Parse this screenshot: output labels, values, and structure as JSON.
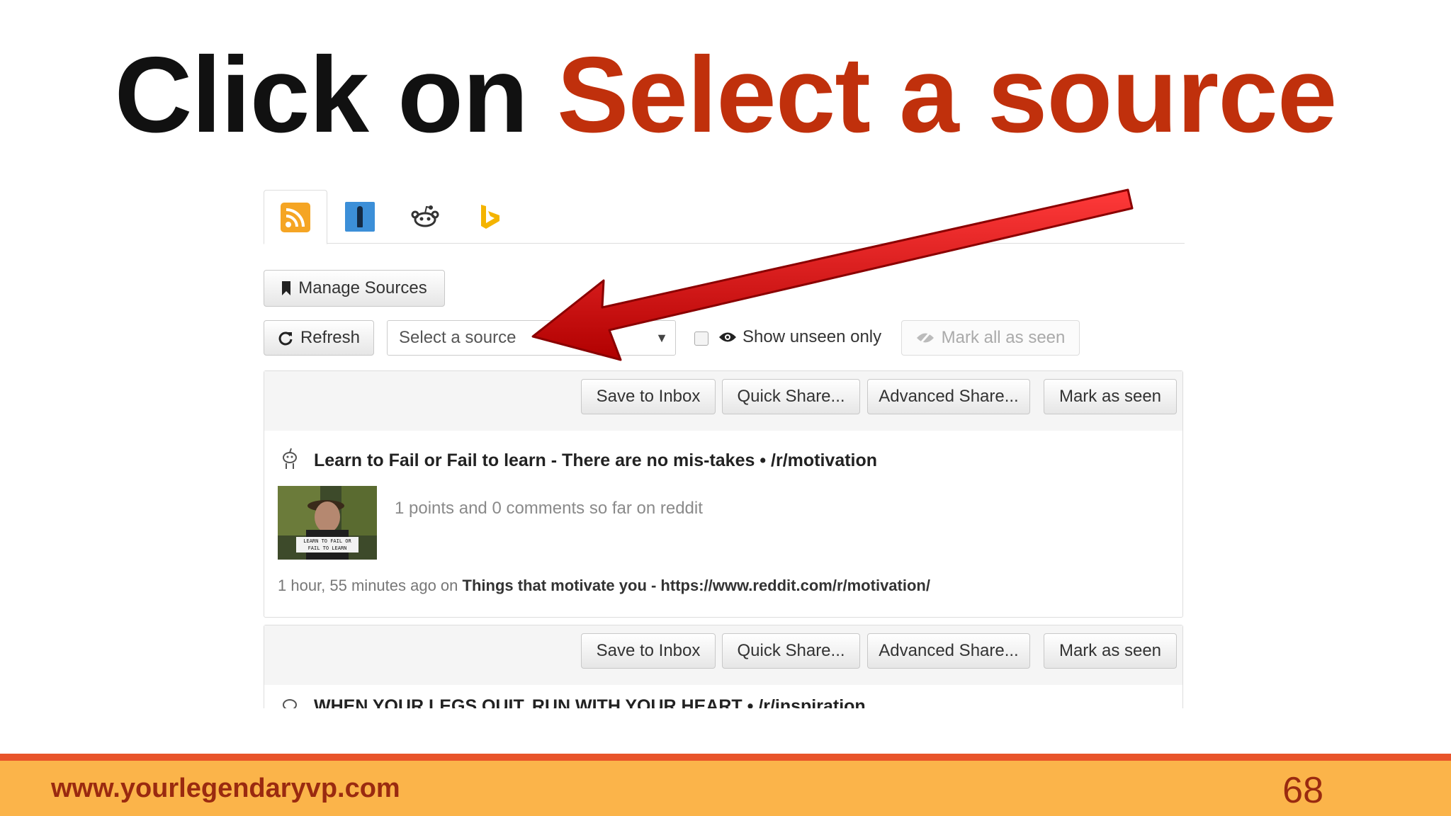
{
  "slide": {
    "title_part1": "Click on ",
    "title_part2": "Select a source",
    "footer_url": "www.yourlegendaryvp.com",
    "page_number": "68",
    "accent_color": "#c0300c",
    "footer_color": "#fbb44a"
  },
  "tabs": [
    {
      "icon": "rss-icon",
      "active": true
    },
    {
      "icon": "klout-icon",
      "active": false
    },
    {
      "icon": "reddit-alien-icon",
      "active": false
    },
    {
      "icon": "bing-icon",
      "active": false
    }
  ],
  "toolbar": {
    "manage_sources_label": "Manage Sources",
    "refresh_label": "Refresh",
    "select_placeholder": "Select a source",
    "show_unseen_label": "Show unseen only",
    "mark_all_seen_label": "Mark all as seen"
  },
  "card_actions": {
    "save_inbox": "Save to Inbox",
    "quick_share": "Quick Share...",
    "advanced_share": "Advanced Share...",
    "mark_seen": "Mark as seen"
  },
  "posts": [
    {
      "title": "Learn to Fail or Fail to learn - There are no mis-takes • /r/motivation",
      "summary": "1 points and 0 comments so far on reddit",
      "thumb_caption_line1": "LEARN TO FAIL OR",
      "thumb_caption_line2": "FAIL TO LEARN",
      "time": "1 hour, 55 minutes ago on ",
      "source": "Things that motivate you - https://www.reddit.com/r/motivation/"
    },
    {
      "title": "WHEN YOUR LEGS QUIT, RUN WITH YOUR HEART • /r/inspiration"
    }
  ],
  "annotation": {
    "arrow_color": "#e01010"
  }
}
